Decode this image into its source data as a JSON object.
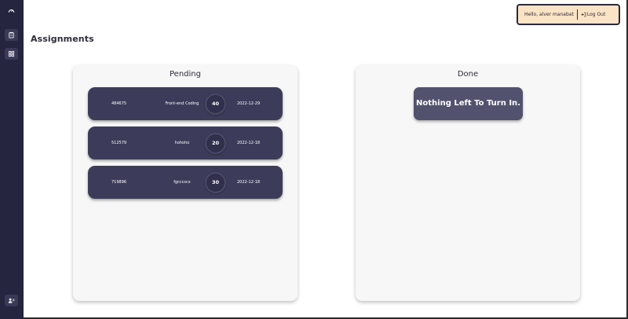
{
  "sidebar": {
    "items": [
      {
        "name": "dashboard",
        "icon": "gauge-icon"
      },
      {
        "name": "assignments",
        "icon": "clipboard-icon"
      },
      {
        "name": "grid",
        "icon": "grid-icon"
      },
      {
        "name": "users",
        "icon": "users-icon"
      }
    ]
  },
  "header": {
    "greeting": "Hello, alver manabat",
    "logout_label": "Log Out"
  },
  "page": {
    "title": "Assignments"
  },
  "pending": {
    "title": "Pending",
    "items": [
      {
        "id": "484675",
        "name": "Front-end Coding",
        "points": "40",
        "date": "2022-12-29"
      },
      {
        "id": "512579",
        "name": "hohoho",
        "points": "20",
        "date": "2022-12-18"
      },
      {
        "id": "719896",
        "name": "fgcccscx",
        "points": "30",
        "date": "2022-12-18"
      }
    ]
  },
  "done": {
    "title": "Done",
    "empty_message": "Nothing Left To Turn In."
  },
  "colors": {
    "sidebar": "#25253f",
    "card": "#3c3c5a",
    "user_box": "#fbe3c5",
    "panel": "#f7f7f7"
  }
}
